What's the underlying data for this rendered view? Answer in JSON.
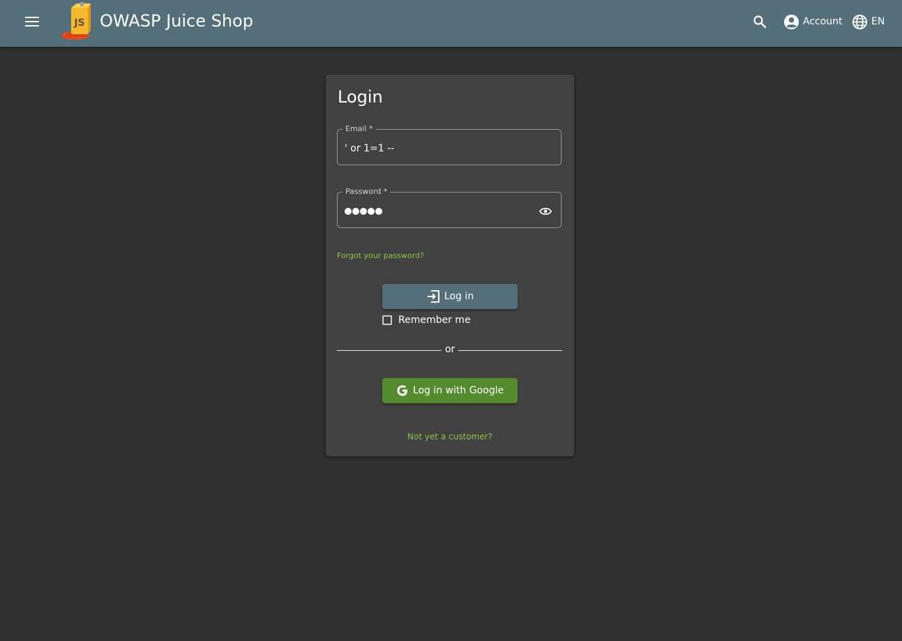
{
  "header": {
    "app_title": "OWASP Juice Shop",
    "logo_text": "JS",
    "menu_icon": "menu-icon",
    "search_icon": "search-icon",
    "account_label": "Account",
    "account_icon": "account-circle-icon",
    "language_label": "EN",
    "language_icon": "globe-icon",
    "background_color": "#546e7a"
  },
  "login": {
    "title": "Login",
    "email": {
      "label": "Email *",
      "value": "' or 1=1 --"
    },
    "password": {
      "label": "Password *",
      "masked_length": 5,
      "visibility_icon": "eye-icon"
    },
    "forgot_password": "Forgot your password?",
    "login_button": "Log in",
    "login_icon": "exit-to-app-icon",
    "remember_me": "Remember me",
    "remember_checked": false,
    "divider_text": "or",
    "google_button": "Log in with Google",
    "google_icon": "google-icon",
    "register_link": "Not yet a customer?"
  },
  "colors": {
    "page_background": "#303030",
    "card_background": "#424242",
    "primary": "#546e7a",
    "accent": "#8bc34a",
    "google_button": "#558b2f"
  }
}
